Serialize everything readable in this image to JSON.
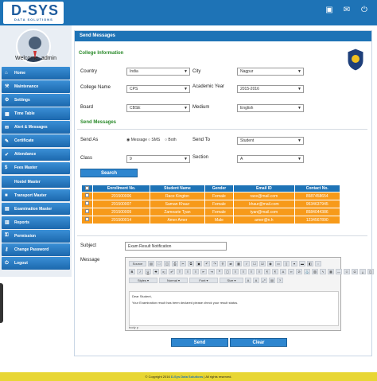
{
  "brand": {
    "name": "D-SYS",
    "tagline": "DATA SOLUTIONS",
    "link_color": "#1e73b6"
  },
  "header": {
    "icons": [
      "monitor-icon",
      "mail-icon",
      "power-icon"
    ]
  },
  "sidebar": {
    "welcome": "Welcome, admin",
    "items": [
      {
        "label": "Home",
        "icon": "home-icon"
      },
      {
        "label": "Maintenance",
        "icon": "wrench-icon"
      },
      {
        "label": "Settings",
        "icon": "gear-icon"
      },
      {
        "label": "Time Table",
        "icon": "table-icon"
      },
      {
        "label": "Alert & Messages",
        "icon": "envelope-icon"
      },
      {
        "label": "Certificate",
        "icon": "certificate-icon"
      },
      {
        "label": "Attendance",
        "icon": "check-icon"
      },
      {
        "label": "Fees Master",
        "icon": "money-icon"
      },
      {
        "label": "Hostel Master",
        "icon": "building-icon"
      },
      {
        "label": "Transport Master",
        "icon": "bus-icon"
      },
      {
        "label": "Examination Master",
        "icon": "exam-icon"
      },
      {
        "label": "Reports",
        "icon": "report-icon"
      },
      {
        "label": "Permission",
        "icon": "lock-icon"
      },
      {
        "label": "Change Password",
        "icon": "key-icon"
      },
      {
        "label": "Logout",
        "icon": "logout-icon"
      }
    ]
  },
  "page": {
    "title": "Send Messages"
  },
  "college_info": {
    "heading": "College Information",
    "country_label": "Country",
    "country": "India",
    "city_label": "City",
    "city": "Nagpur",
    "college_label": "College Name",
    "college": "CPS",
    "year_label": "Academic Year",
    "year": "2015-2016",
    "board_label": "Board",
    "board": "CBSE",
    "medium_label": "Medium",
    "medium": "English"
  },
  "send_messages": {
    "heading": "Send Messages",
    "send_as_label": "Send As",
    "radio_message": "Message",
    "radio_sms": "SMS",
    "radio_both": "Both",
    "send_to_label": "Send To",
    "send_to": "Student",
    "class_label": "Class",
    "class": "9",
    "section_label": "Section",
    "section": "A",
    "search_label": "Search"
  },
  "table": {
    "headers": [
      "Enrollment No.",
      "Student Name",
      "Gender",
      "Email ID",
      "Contact No."
    ],
    "rows": [
      [
        "201500006",
        "Race   Kington",
        "Female",
        "race@mail.com",
        "8587458654"
      ],
      [
        "201500007",
        "Saman   Khaur",
        "Female",
        "khaur@mail.com",
        "9534637945"
      ],
      [
        "201500009",
        "Zamearie   Tyan",
        "Female",
        "tyan@mail.com",
        "8584044386"
      ],
      [
        "201500014",
        "Amer   Amer",
        "Male",
        "amer@n.h",
        "1234567890"
      ]
    ]
  },
  "message": {
    "subject_label": "Subject",
    "subject_value": "Exam  Result Notification",
    "message_label": "Message",
    "source_label": "Source",
    "style_label": "Styles",
    "format_label": "Normal",
    "font_label": "Font",
    "size_label": "Size",
    "body_line1": "Dear Student,",
    "body_line2": "Your Examination result has been declared please check your result status.",
    "path_label": "body  p"
  },
  "actions": {
    "send": "Send",
    "clear": "Clear"
  },
  "footer": {
    "copyright": "© Copyright 2016",
    "company": "D-Sys Data Solutions",
    "rights": "| All rights reserved."
  }
}
